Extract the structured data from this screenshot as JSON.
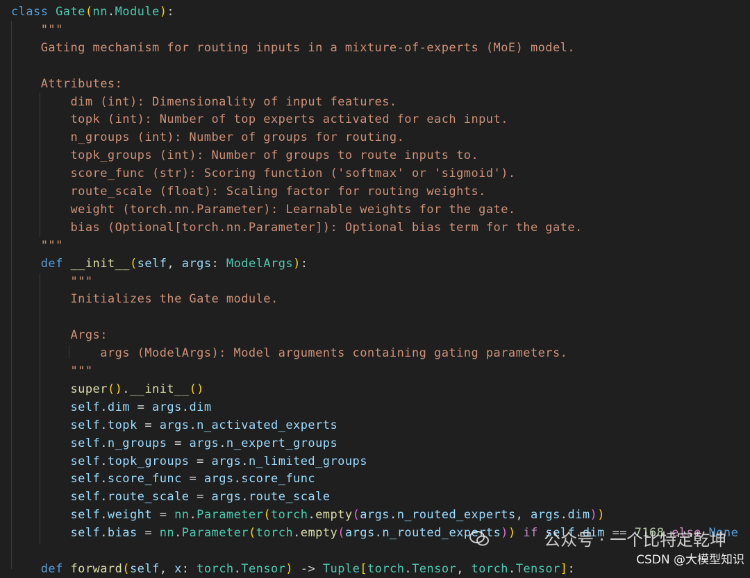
{
  "theme": {
    "background": "#1f1f1f",
    "keyword": "#569cd6",
    "class_name": "#4ec9b0",
    "function": "#dcdcaa",
    "variable": "#9cdcfe",
    "string": "#ce9178",
    "number": "#b5cea8",
    "bracket_1": "#ffd700",
    "bracket_2": "#da70d6",
    "bracket_3": "#179fff"
  },
  "code_lines": [
    [
      [
        "kw",
        "class "
      ],
      [
        "cls",
        "Gate"
      ],
      [
        "p1",
        "("
      ],
      [
        "cls",
        "nn"
      ],
      [
        "op",
        "."
      ],
      [
        "cls",
        "Module"
      ],
      [
        "p1",
        ")"
      ],
      [
        "op",
        ":"
      ]
    ],
    [
      [
        "str",
        "    \"\"\""
      ]
    ],
    [
      [
        "str",
        "    Gating mechanism for routing inputs in a mixture-of-experts (MoE) model."
      ]
    ],
    [
      [
        "str",
        ""
      ]
    ],
    [
      [
        "str",
        "    Attributes:"
      ]
    ],
    [
      [
        "str",
        "        dim (int): Dimensionality of input features."
      ]
    ],
    [
      [
        "str",
        "        topk (int): Number of top experts activated for each input."
      ]
    ],
    [
      [
        "str",
        "        n_groups (int): Number of groups for routing."
      ]
    ],
    [
      [
        "str",
        "        topk_groups (int): Number of groups to route inputs to."
      ]
    ],
    [
      [
        "str",
        "        score_func (str): Scoring function ('softmax' or 'sigmoid')."
      ]
    ],
    [
      [
        "str",
        "        route_scale (float): Scaling factor for routing weights."
      ]
    ],
    [
      [
        "str",
        "        weight (torch.nn.Parameter): Learnable weights for the gate."
      ]
    ],
    [
      [
        "str",
        "        bias (Optional[torch.nn.Parameter]): Optional bias term for the gate."
      ]
    ],
    [
      [
        "str",
        "    \"\"\""
      ]
    ],
    [
      [
        "kw",
        "    def "
      ],
      [
        "fn",
        "__init__"
      ],
      [
        "p1",
        "("
      ],
      [
        "var",
        "self"
      ],
      [
        "op",
        ", "
      ],
      [
        "var",
        "args"
      ],
      [
        "op",
        ": "
      ],
      [
        "cls",
        "ModelArgs"
      ],
      [
        "p1",
        ")"
      ],
      [
        "op",
        ":"
      ]
    ],
    [
      [
        "str",
        "        \"\"\""
      ]
    ],
    [
      [
        "str",
        "        Initializes the Gate module."
      ]
    ],
    [
      [
        "str",
        ""
      ]
    ],
    [
      [
        "str",
        "        Args:"
      ]
    ],
    [
      [
        "str",
        "            args (ModelArgs): Model arguments containing gating parameters."
      ]
    ],
    [
      [
        "str",
        "        \"\"\""
      ]
    ],
    [
      [
        "fn",
        "        super"
      ],
      [
        "p1",
        "()"
      ],
      [
        "op",
        "."
      ],
      [
        "fn",
        "__init__"
      ],
      [
        "p1",
        "()"
      ]
    ],
    [
      [
        "var",
        "        self"
      ],
      [
        "op",
        "."
      ],
      [
        "var",
        "dim"
      ],
      [
        "op",
        " = "
      ],
      [
        "var",
        "args"
      ],
      [
        "op",
        "."
      ],
      [
        "var",
        "dim"
      ]
    ],
    [
      [
        "var",
        "        self"
      ],
      [
        "op",
        "."
      ],
      [
        "var",
        "topk"
      ],
      [
        "op",
        " = "
      ],
      [
        "var",
        "args"
      ],
      [
        "op",
        "."
      ],
      [
        "var",
        "n_activated_experts"
      ]
    ],
    [
      [
        "var",
        "        self"
      ],
      [
        "op",
        "."
      ],
      [
        "var",
        "n_groups"
      ],
      [
        "op",
        " = "
      ],
      [
        "var",
        "args"
      ],
      [
        "op",
        "."
      ],
      [
        "var",
        "n_expert_groups"
      ]
    ],
    [
      [
        "var",
        "        self"
      ],
      [
        "op",
        "."
      ],
      [
        "var",
        "topk_groups"
      ],
      [
        "op",
        " = "
      ],
      [
        "var",
        "args"
      ],
      [
        "op",
        "."
      ],
      [
        "var",
        "n_limited_groups"
      ]
    ],
    [
      [
        "var",
        "        self"
      ],
      [
        "op",
        "."
      ],
      [
        "var",
        "score_func"
      ],
      [
        "op",
        " = "
      ],
      [
        "var",
        "args"
      ],
      [
        "op",
        "."
      ],
      [
        "var",
        "score_func"
      ]
    ],
    [
      [
        "var",
        "        self"
      ],
      [
        "op",
        "."
      ],
      [
        "var",
        "route_scale"
      ],
      [
        "op",
        " = "
      ],
      [
        "var",
        "args"
      ],
      [
        "op",
        "."
      ],
      [
        "var",
        "route_scale"
      ]
    ],
    [
      [
        "var",
        "        self"
      ],
      [
        "op",
        "."
      ],
      [
        "var",
        "weight"
      ],
      [
        "op",
        " = "
      ],
      [
        "cls",
        "nn"
      ],
      [
        "op",
        "."
      ],
      [
        "cls",
        "Parameter"
      ],
      [
        "p1",
        "("
      ],
      [
        "cls",
        "torch"
      ],
      [
        "op",
        "."
      ],
      [
        "fn",
        "empty"
      ],
      [
        "p2",
        "("
      ],
      [
        "var",
        "args"
      ],
      [
        "op",
        "."
      ],
      [
        "var",
        "n_routed_experts"
      ],
      [
        "op",
        ", "
      ],
      [
        "var",
        "args"
      ],
      [
        "op",
        "."
      ],
      [
        "var",
        "dim"
      ],
      [
        "p2",
        ")"
      ],
      [
        "p1",
        ")"
      ]
    ],
    [
      [
        "var",
        "        self"
      ],
      [
        "op",
        "."
      ],
      [
        "var",
        "bias"
      ],
      [
        "op",
        " = "
      ],
      [
        "cls",
        "nn"
      ],
      [
        "op",
        "."
      ],
      [
        "cls",
        "Parameter"
      ],
      [
        "p1",
        "("
      ],
      [
        "cls",
        "torch"
      ],
      [
        "op",
        "."
      ],
      [
        "fn",
        "empty"
      ],
      [
        "p2",
        "("
      ],
      [
        "var",
        "args"
      ],
      [
        "op",
        "."
      ],
      [
        "var",
        "n_routed_experts"
      ],
      [
        "p2",
        ")"
      ],
      [
        "p1",
        ")"
      ],
      [
        "ctrl",
        " if "
      ],
      [
        "var",
        "self"
      ],
      [
        "op",
        "."
      ],
      [
        "var",
        "dim"
      ],
      [
        "op",
        " == "
      ],
      [
        "num",
        "7168"
      ],
      [
        "ctrl",
        " else "
      ],
      [
        "kw",
        "None"
      ]
    ],
    [
      [
        "str",
        ""
      ]
    ],
    [
      [
        "kw",
        "    def "
      ],
      [
        "fn",
        "forward"
      ],
      [
        "p1",
        "("
      ],
      [
        "var",
        "self"
      ],
      [
        "op",
        ", "
      ],
      [
        "var",
        "x"
      ],
      [
        "op",
        ": "
      ],
      [
        "cls",
        "torch"
      ],
      [
        "op",
        "."
      ],
      [
        "cls",
        "Tensor"
      ],
      [
        "p1",
        ")"
      ],
      [
        "op",
        " -> "
      ],
      [
        "cls",
        "Tuple"
      ],
      [
        "p1",
        "["
      ],
      [
        "cls",
        "torch"
      ],
      [
        "op",
        "."
      ],
      [
        "cls",
        "Tensor"
      ],
      [
        "op",
        ", "
      ],
      [
        "cls",
        "torch"
      ],
      [
        "op",
        "."
      ],
      [
        "cls",
        "Tensor"
      ],
      [
        "p1",
        "]"
      ],
      [
        "op",
        ":"
      ]
    ]
  ],
  "watermark": {
    "top_text": "公众号 · 一个比特定乾坤",
    "bottom_text": "CSDN @大模型知识"
  }
}
